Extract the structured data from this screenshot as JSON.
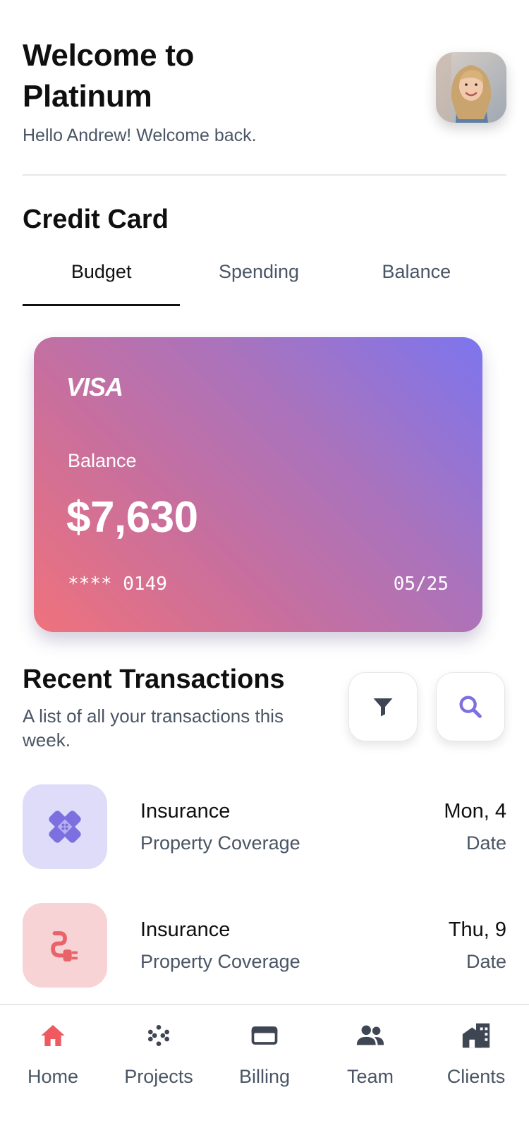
{
  "header": {
    "title_line1": "Welcome to",
    "title_line2": "Platinum",
    "subtitle": "Hello Andrew! Welcome back."
  },
  "credit_card": {
    "section_title": "Credit Card",
    "tabs": [
      {
        "label": "Budget",
        "active": true
      },
      {
        "label": "Spending",
        "active": false
      },
      {
        "label": "Balance",
        "active": false
      }
    ],
    "card": {
      "brand": "VISA",
      "balance_label": "Balance",
      "balance": "$7,630",
      "number": "**** 0149",
      "expiry": "05/25",
      "gradient_colors": [
        "#ef727c",
        "#c86f9d",
        "#a973bd",
        "#7d75ee"
      ]
    }
  },
  "recent_transactions": {
    "title": "Recent Transactions",
    "subtitle": "A list of all your transactions this week.",
    "filter_icon": "filter-icon",
    "search_icon": "search-icon",
    "items": [
      {
        "icon": "bandage-icon",
        "icon_color": "#7c6fe0",
        "icon_bg": "#dedcf9",
        "title": "Insurance",
        "subtitle": "Property Coverage",
        "date": "Mon, 4",
        "date_label": "Date"
      },
      {
        "icon": "plug-icon",
        "icon_color": "#e9636b",
        "icon_bg": "#f8d3d6",
        "title": "Insurance",
        "subtitle": "Property Coverage",
        "date": "Thu, 9",
        "date_label": "Date"
      }
    ]
  },
  "bottom_nav": {
    "items": [
      {
        "label": "Home",
        "icon": "home-icon",
        "active": true
      },
      {
        "label": "Projects",
        "icon": "dots-grid-icon",
        "active": false
      },
      {
        "label": "Billing",
        "icon": "credit-card-icon",
        "active": false
      },
      {
        "label": "Team",
        "icon": "people-icon",
        "active": false
      },
      {
        "label": "Clients",
        "icon": "building-icon",
        "active": false
      }
    ]
  },
  "colors": {
    "accent_red": "#ef5a61",
    "accent_purple": "#7c6fe0",
    "text_secondary": "#4a5565"
  }
}
